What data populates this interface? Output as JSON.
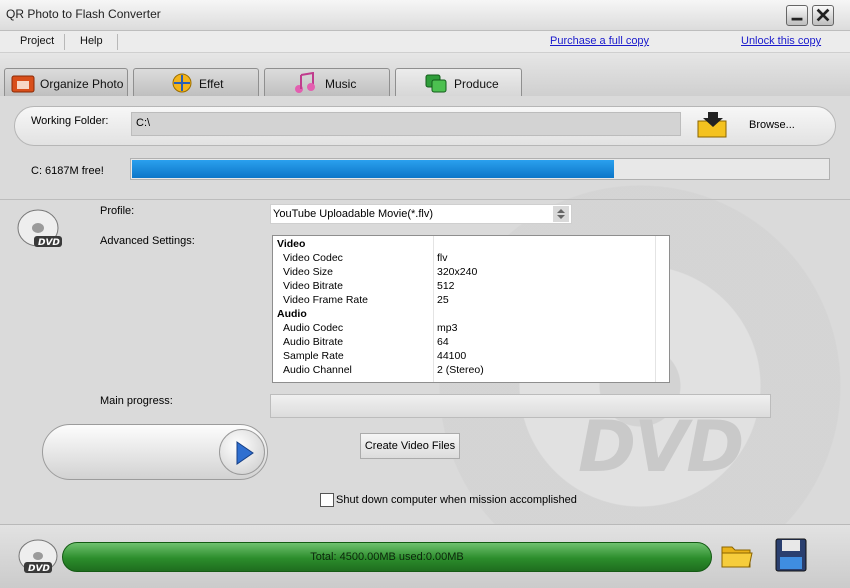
{
  "window": {
    "title": "QR Photo to Flash Converter"
  },
  "menu": {
    "items": [
      "Project",
      "Help"
    ],
    "purchase_link": "Purchase a full copy",
    "unlock_link": "Unlock this copy"
  },
  "tabs": [
    {
      "label": "Organize Photo",
      "icon": "photo-icon"
    },
    {
      "label": "Effet",
      "icon": "effect-icon"
    },
    {
      "label": "Music",
      "icon": "music-note-icon"
    },
    {
      "label": "Produce",
      "icon": "produce-icon",
      "active": true
    }
  ],
  "working_folder": {
    "label": "Working Folder:",
    "value": "C:\\",
    "browse_label": "Browse..."
  },
  "disk": {
    "free_text": "C: 6187M free!",
    "free_fraction": 0.69
  },
  "profile": {
    "label": "Profile:",
    "value": "YouTube Uploadable Movie(*.flv)"
  },
  "advanced": {
    "label": "Advanced Settings:",
    "groups": [
      {
        "name": "Video",
        "rows": [
          {
            "key": "Video Codec",
            "value": "flv"
          },
          {
            "key": "Video Size",
            "value": "320x240"
          },
          {
            "key": "Video Bitrate",
            "value": "512"
          },
          {
            "key": "Video Frame Rate",
            "value": "25"
          }
        ]
      },
      {
        "name": "Audio",
        "rows": [
          {
            "key": "Audio Codec",
            "value": "mp3"
          },
          {
            "key": "Audio Bitrate",
            "value": "64"
          },
          {
            "key": "Sample Rate",
            "value": "44100"
          },
          {
            "key": "Audio Channel",
            "value": "2 (Stereo)"
          }
        ]
      }
    ]
  },
  "progress": {
    "label": "Main progress:",
    "value": 0
  },
  "actions": {
    "create_label": "Create Video Files",
    "shutdown_label": "Shut down computer when mission accomplished",
    "shutdown_checked": false
  },
  "status": {
    "total_text": "Total: 4500.00MB used:0.00MB",
    "used_fraction": 1.0
  },
  "colors": {
    "free_bar": "#0d76c8",
    "total_bar": "#2c8d2c",
    "link": "#1a1acc"
  }
}
